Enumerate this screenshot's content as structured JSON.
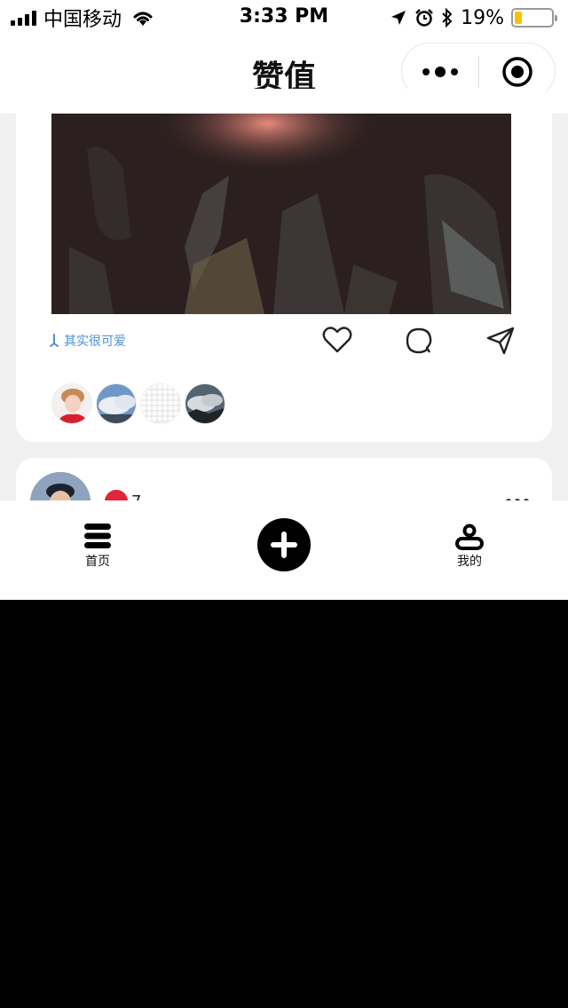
{
  "status_bar": {
    "carrier": "中国移动",
    "time": "3:33 PM",
    "battery_text": "19%",
    "battery_level": 0.19,
    "battery_color": "#f5c400"
  },
  "nav": {
    "title": "赞值",
    "more_icon": "more-dots-icon",
    "close_icon": "miniprogram-close-icon"
  },
  "feed": {
    "posts": [
      {
        "tag": "其实很可爱",
        "actions": [
          "heart-icon",
          "comment-icon",
          "share-icon"
        ],
        "liker_count_shown": 4
      },
      {
        "author_badge_color": "#e0263a",
        "author_name": "7..."
      }
    ]
  },
  "tab_bar": {
    "home_label": "首页",
    "add_icon": "plus-icon",
    "mine_label": "我的"
  },
  "accent": "#4a90d9"
}
